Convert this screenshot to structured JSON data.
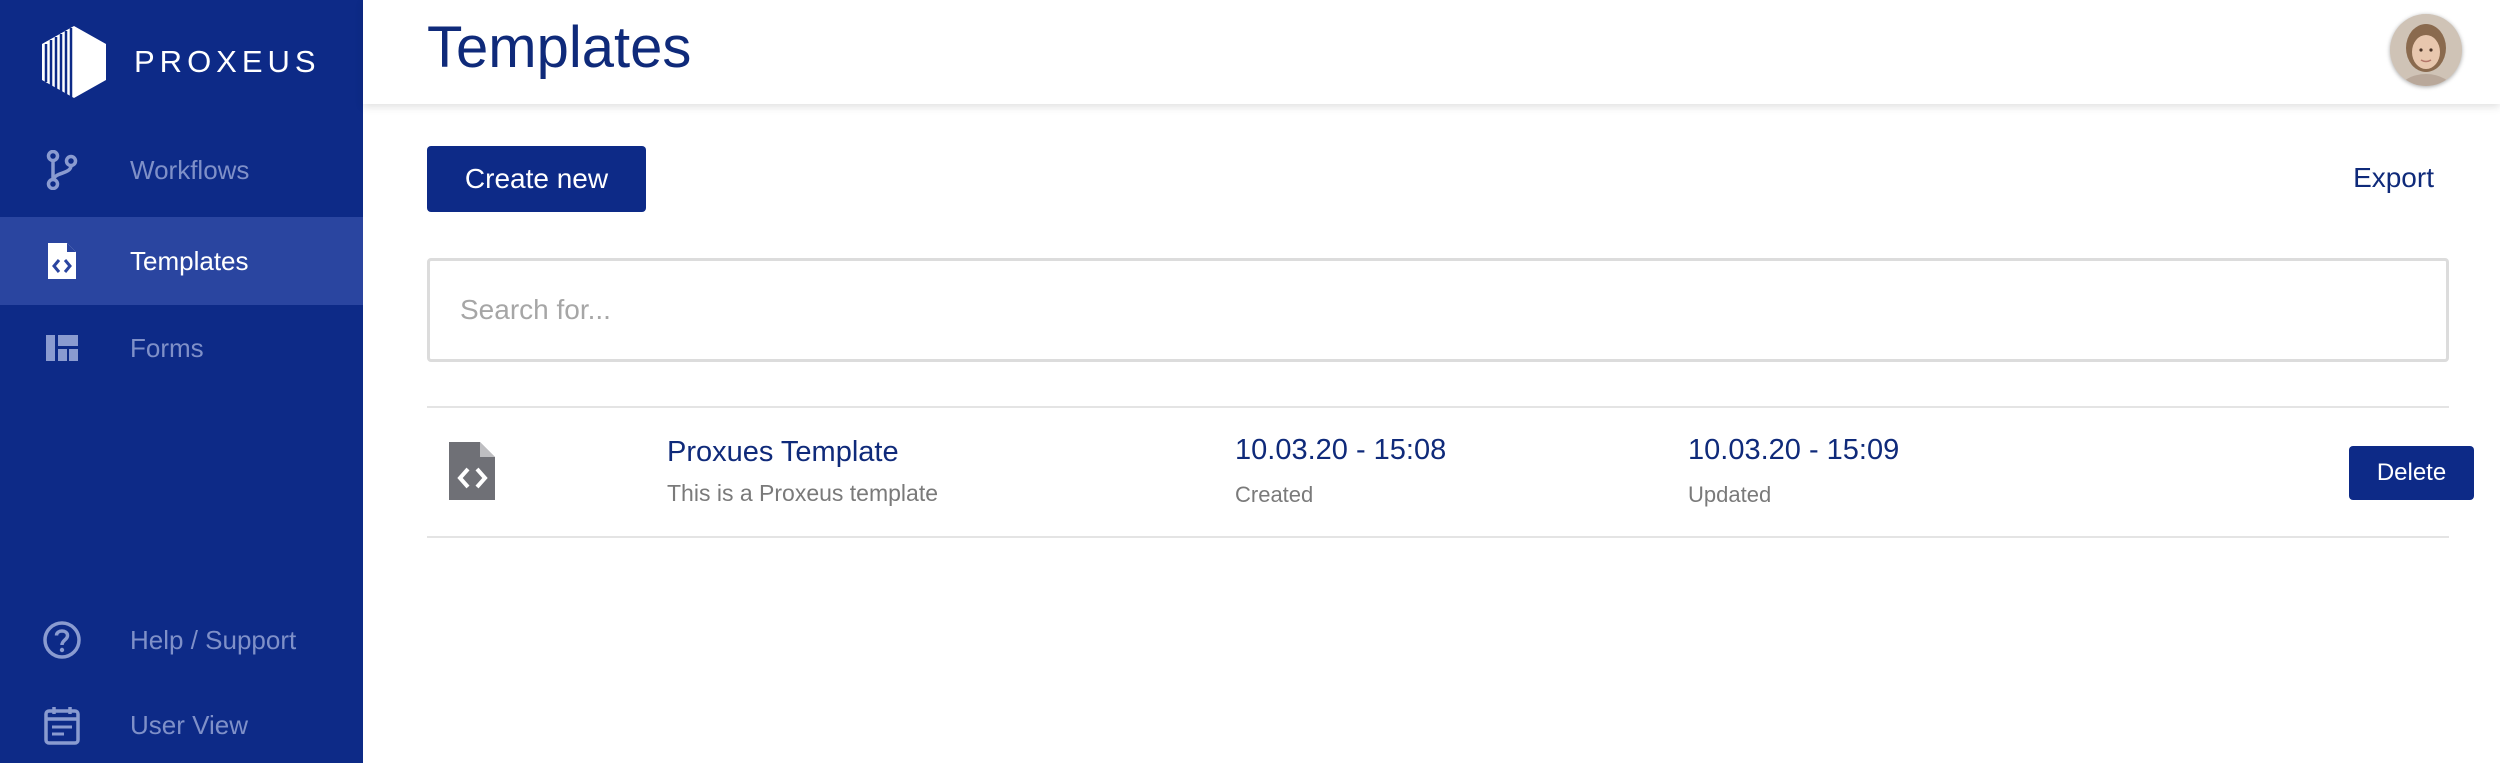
{
  "brand": {
    "name": "PROXEUS"
  },
  "sidebar": {
    "items": [
      {
        "label": "Workflows",
        "icon": "workflow-icon",
        "active": false
      },
      {
        "label": "Templates",
        "icon": "template-icon",
        "active": true
      },
      {
        "label": "Forms",
        "icon": "forms-icon",
        "active": false
      },
      {
        "label": "Help / Support",
        "icon": "help-icon",
        "active": false
      },
      {
        "label": "User View",
        "icon": "calendar-icon",
        "active": false
      }
    ]
  },
  "header": {
    "title": "Templates"
  },
  "toolbar": {
    "create_label": "Create new",
    "export_label": "Export"
  },
  "search": {
    "placeholder": "Search for..."
  },
  "templates": [
    {
      "name": "Proxues Template",
      "description": "This is a Proxeus template",
      "created": "10.03.20 - 15:08",
      "created_label": "Created",
      "updated": "10.03.20 - 15:09",
      "updated_label": "Updated",
      "delete_label": "Delete"
    }
  ],
  "colors": {
    "sidebar_bg": "#0d2a87",
    "sidebar_active_bg": "#2a45a0",
    "accent": "#0f2a7a"
  }
}
